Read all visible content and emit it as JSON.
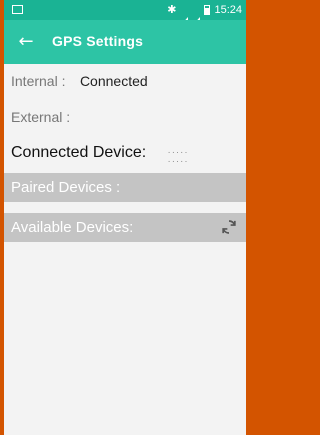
{
  "status_bar": {
    "time": "15:24",
    "icons": [
      "bluetooth-icon",
      "signal-icon",
      "battery-icon"
    ]
  },
  "toolbar": {
    "title": "GPS Settings",
    "back_icon": "arrow-left-icon"
  },
  "gps": {
    "internal_label": "Internal :",
    "internal_value": "Connected",
    "external_label": "External :",
    "connected_device_label": "Connected Device:",
    "connected_device_value_1": ".....",
    "connected_device_value_2": "....."
  },
  "sections": {
    "paired": "Paired Devices :",
    "available": "Available Devices:"
  },
  "colors": {
    "toolbar": "#2dc4a5",
    "statusbar": "#1ab394",
    "section_bar": "#c4c4c4",
    "frame": "#d35400"
  }
}
